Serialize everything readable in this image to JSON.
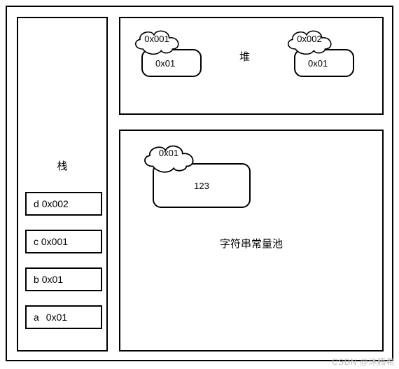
{
  "stack": {
    "title": "栈",
    "entries": [
      {
        "var": "d",
        "addr": "0x002"
      },
      {
        "var": "c",
        "addr": "0x001"
      },
      {
        "var": "b",
        "addr": "0x01"
      },
      {
        "var": "a",
        "addr": "0x01"
      }
    ]
  },
  "heap": {
    "title": "堆",
    "objects": [
      {
        "cloud_addr": "0x001",
        "box_value": "0x01"
      },
      {
        "cloud_addr": "0x002",
        "box_value": "0x01"
      }
    ]
  },
  "string_constant_pool": {
    "title": "字符串常量池",
    "cloud_addr": "0x01",
    "value": "123"
  },
  "watermark": "CSDN @沐腾希"
}
